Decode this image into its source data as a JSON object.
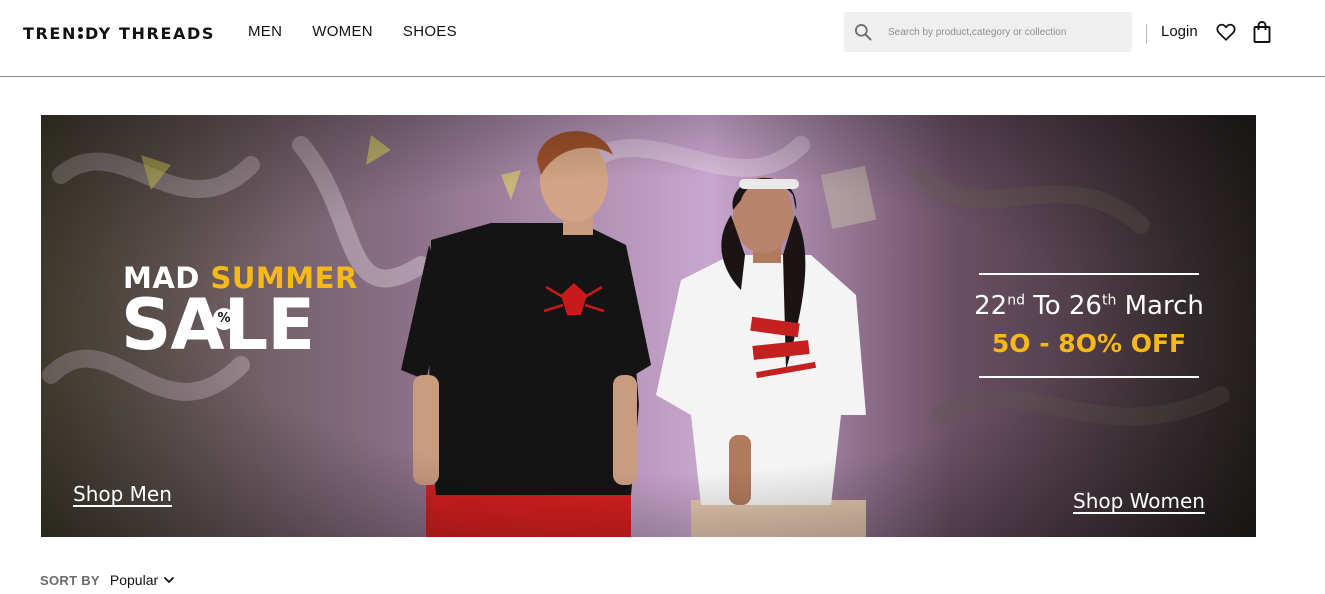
{
  "brand": {
    "name_part1": "TREN",
    "name_part2": "DY THREADS"
  },
  "nav": {
    "items": [
      "MEN",
      "WOMEN",
      "SHOES"
    ]
  },
  "search": {
    "placeholder": "Search by product,category or collection",
    "icon": "search-icon"
  },
  "account": {
    "login_label": "Login",
    "wishlist_icon": "heart-icon",
    "bag_icon": "shopping-bag-icon"
  },
  "banner": {
    "headline_part1": "MAD ",
    "headline_part2": "SUMMER",
    "sale_word": "SALE",
    "sale_badge": "%",
    "date_start_num": "22",
    "date_start_suffix": "nd",
    "date_to": " To ",
    "date_end_num": "26",
    "date_end_suffix": "th",
    "date_month": " March",
    "discount": "5O - 8O% OFF",
    "shop_men": "Shop Men",
    "shop_women": "Shop Women",
    "colors": {
      "accent": "#f7b819",
      "text": "#ffffff"
    }
  },
  "sort": {
    "label": "SORT BY",
    "value": "Popular",
    "icon": "chevron-down-icon"
  }
}
